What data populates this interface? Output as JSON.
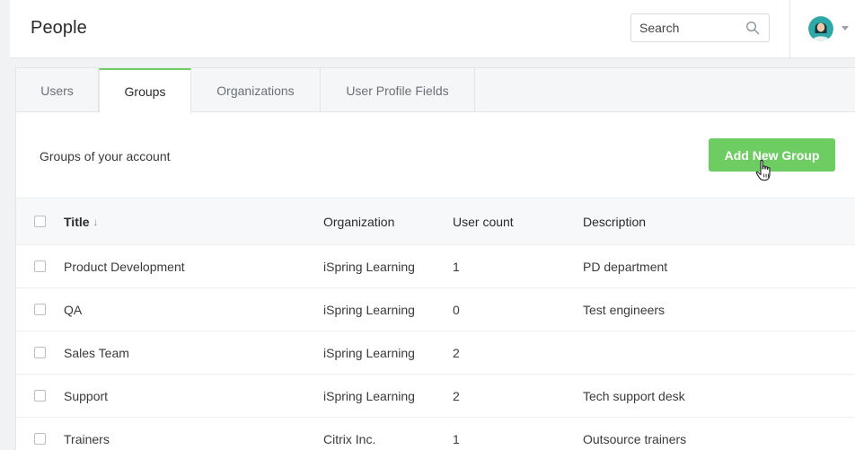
{
  "header": {
    "title": "People",
    "search_placeholder": "Search",
    "icons": {
      "search": "search-icon",
      "avatar": "user-avatar",
      "caret": "chevron-down-icon"
    }
  },
  "tabs": [
    {
      "label": "Users",
      "active": false
    },
    {
      "label": "Groups",
      "active": true
    },
    {
      "label": "Organizations",
      "active": false
    },
    {
      "label": "User Profile Fields",
      "active": false
    }
  ],
  "section": {
    "label": "Groups of your account",
    "add_button": "Add New Group"
  },
  "table": {
    "columns": {
      "title": "Title",
      "sort": "↓",
      "organization": "Organization",
      "user_count": "User count",
      "description": "Description"
    },
    "rows": [
      {
        "title": "Product Development",
        "organization": "iSpring Learning",
        "user_count": "1",
        "description": "PD department"
      },
      {
        "title": "QA",
        "organization": "iSpring Learning",
        "user_count": "0",
        "description": "Test engineers"
      },
      {
        "title": "Sales Team",
        "organization": "iSpring Learning",
        "user_count": "2",
        "description": ""
      },
      {
        "title": "Support",
        "organization": "iSpring Learning",
        "user_count": "2",
        "description": "Tech support desk"
      },
      {
        "title": "Trainers",
        "organization": "Citrix Inc.",
        "user_count": "1",
        "description": "Outsource trainers"
      }
    ]
  },
  "colors": {
    "accent": "#6dcc62",
    "background": "#f1f2f4",
    "avatar": "#2fa8a8"
  }
}
